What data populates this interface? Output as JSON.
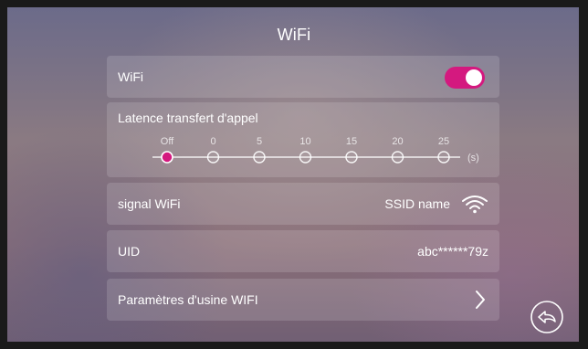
{
  "page": {
    "title": "WiFi"
  },
  "wifi_row": {
    "label": "WiFi",
    "enabled": true,
    "toggle_color": "#d4197f"
  },
  "latency": {
    "label": "Latence transfert d'appel",
    "options": [
      "Off",
      "0",
      "5",
      "10",
      "15",
      "20",
      "25"
    ],
    "selected_index": 0,
    "unit": "(s)",
    "accent": "#d4197f"
  },
  "signal_row": {
    "label": "signal WiFi",
    "ssid": "SSID name",
    "icon": "wifi-signal-icon"
  },
  "uid_row": {
    "label": "UID",
    "value": "abc******79z"
  },
  "factory_row": {
    "label": "Paramètres d'usine WIFI",
    "icon": "chevron-right-icon"
  },
  "back_button": {
    "icon": "back-arrow-icon"
  }
}
